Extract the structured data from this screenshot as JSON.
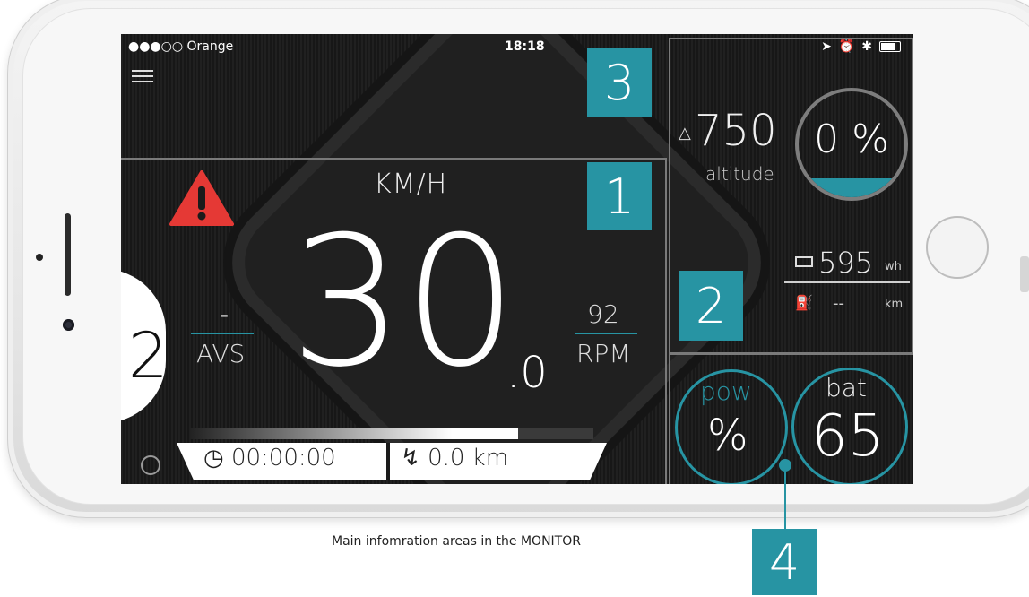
{
  "status": {
    "carrier": "●●●○○ Orange",
    "time": "18:18"
  },
  "speed": {
    "unit_label": "KM/H",
    "integer": "30",
    "decimal": ".0"
  },
  "avs": {
    "value": "-",
    "label": "AVS"
  },
  "rpm": {
    "value": "92",
    "label": "RPM"
  },
  "gear": {
    "value": "2"
  },
  "trip": {
    "time": "00:00:00",
    "distance": "0.0 km"
  },
  "altitude": {
    "value": "750",
    "label": "altitude"
  },
  "grade": {
    "value": "0 %"
  },
  "energy": {
    "value": "595",
    "unit": "wh"
  },
  "range": {
    "value": "--",
    "unit": "km"
  },
  "power": {
    "label": "pow",
    "value": "%"
  },
  "battery": {
    "label": "bat",
    "value": "65"
  },
  "badges": {
    "one": "1",
    "two": "2",
    "three": "3",
    "four": "4"
  },
  "caption": "Main infomration areas in the MONITOR",
  "colors": {
    "accent": "#2794a3",
    "warning": "#e53935"
  }
}
